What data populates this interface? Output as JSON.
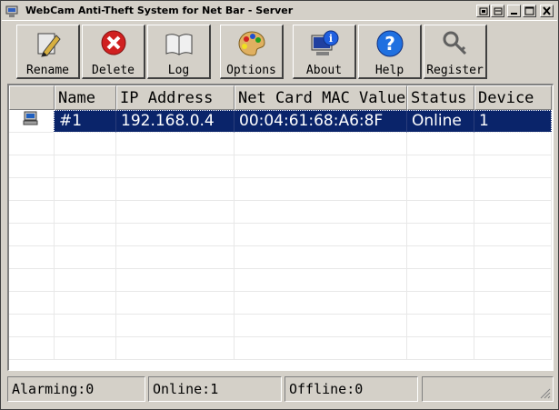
{
  "window": {
    "title": "WebCam Anti-Theft System for Net Bar - Server"
  },
  "title_buttons": [
    "minimize-icon",
    "restore-icon",
    "maximize-icon",
    "close-icon"
  ],
  "toolbar": {
    "rename": "Rename",
    "delete": "Delete",
    "log": "Log",
    "options": "Options",
    "about": "About",
    "help": "Help",
    "register": "Register"
  },
  "table": {
    "columns": [
      "",
      "Name",
      "IP Address",
      "Net Card MAC Value",
      "Status",
      "Device"
    ],
    "rows": [
      {
        "icon": "computer-icon",
        "name": "#1",
        "ip": "192.168.0.4",
        "mac": "00:04:61:68:A6:8F",
        "status": "Online",
        "device": "1",
        "selected": true
      }
    ]
  },
  "status": {
    "alarming": "Alarming:0",
    "online": "Online:1",
    "offline": "Offline:0"
  },
  "colors": {
    "selection": "#0a246a",
    "face": "#d4d0c8"
  }
}
